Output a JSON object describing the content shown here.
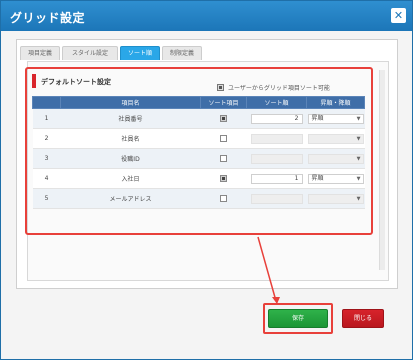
{
  "window": {
    "title": "グリッド設定",
    "close_glyph": "✕"
  },
  "tabs": [
    {
      "label": "項目定義"
    },
    {
      "label": "スタイル設定"
    },
    {
      "label": "ソート順"
    },
    {
      "label": "制限定義"
    }
  ],
  "active_tab": "ソート順",
  "section": {
    "title": "デフォルトソート設定",
    "user_sort_label": "ユーザーからグリッド項目ソート可能",
    "user_sort_checked": true
  },
  "table": {
    "headers": [
      "",
      "項目名",
      "ソート項目",
      "ソート順",
      "昇順・降順"
    ],
    "rows": [
      {
        "no": "1",
        "name": "社員番号",
        "checked": true,
        "order": "2",
        "direction": "昇順"
      },
      {
        "no": "2",
        "name": "社員名",
        "checked": false,
        "order": "",
        "direction": ""
      },
      {
        "no": "3",
        "name": "役職ID",
        "checked": false,
        "order": "",
        "direction": ""
      },
      {
        "no": "4",
        "name": "入社日",
        "checked": true,
        "order": "1",
        "direction": "昇順"
      },
      {
        "no": "5",
        "name": "メールアドレス",
        "checked": false,
        "order": "",
        "direction": ""
      }
    ]
  },
  "buttons": {
    "ok": "保存",
    "cancel": "閉じる"
  },
  "colors": {
    "titlebar": "#1c76b8",
    "header": "#3f6ea8",
    "active_tab": "#2aa7e8",
    "ok": "#1b9535",
    "cancel": "#c41d24",
    "highlight": "#e8403a"
  },
  "icons": {
    "close": "close-icon",
    "dropdown": "chevron-down-icon"
  }
}
